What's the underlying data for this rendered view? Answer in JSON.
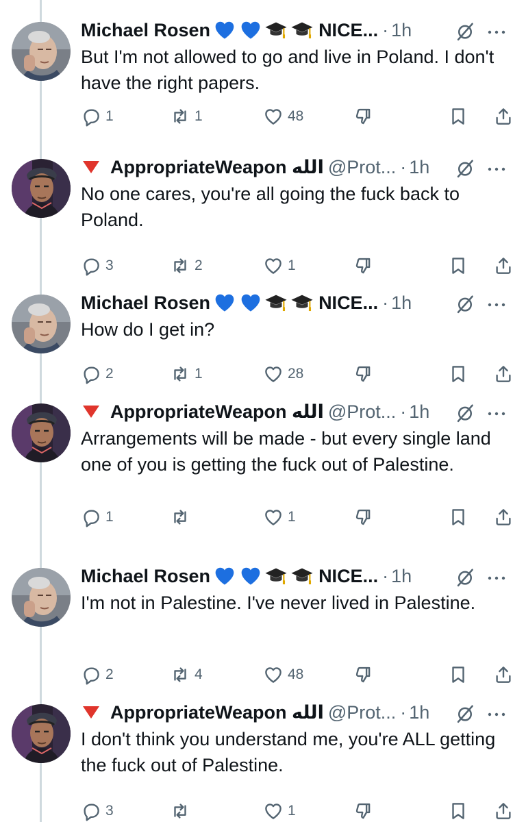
{
  "tweets": [
    {
      "author": "Michael Rosen",
      "author_type": "rosen",
      "name_suffix": "NICE...",
      "handle": "",
      "dot": "·",
      "time": "1h",
      "text": "But I'm not allowed to go and live in Poland. I don't have the right papers.",
      "replies": "1",
      "reposts": "1",
      "likes": "48"
    },
    {
      "author": "AppropriateWeapon الله",
      "author_type": "weapon",
      "name_suffix": "",
      "handle": "@Prot...",
      "dot": "·",
      "time": "1h",
      "text": "No one cares, you're all going the fuck back to Poland.",
      "replies": "3",
      "reposts": "2",
      "likes": "1"
    },
    {
      "author": "Michael Rosen",
      "author_type": "rosen",
      "name_suffix": "NICE...",
      "handle": "",
      "dot": "·",
      "time": "1h",
      "text": "How do I get in?",
      "replies": "2",
      "reposts": "1",
      "likes": "28"
    },
    {
      "author": "AppropriateWeapon الله",
      "author_type": "weapon",
      "name_suffix": "",
      "handle": "@Prot...",
      "dot": "·",
      "time": "1h",
      "text": "Arrangements will be made - but every single land one of you is getting the fuck out of Palestine.",
      "replies": "1",
      "reposts": "",
      "likes": "1"
    },
    {
      "author": "Michael Rosen",
      "author_type": "rosen",
      "name_suffix": "NICE...",
      "handle": "",
      "dot": "·",
      "time": "1h",
      "text": "I'm not in Palestine. I've never lived in Palestine.",
      "replies": "2",
      "reposts": "4",
      "likes": "48"
    },
    {
      "author": "AppropriateWeapon الله",
      "author_type": "weapon",
      "name_suffix": "",
      "handle": "@Prot...",
      "dot": "·",
      "time": "1h",
      "text": "I don't think you understand me, you're ALL getting the fuck out of Palestine.",
      "replies": "3",
      "reposts": "",
      "likes": "1"
    }
  ],
  "icons": {
    "reply": "reply-icon",
    "repost": "repost-icon",
    "like": "heart-icon",
    "downvote": "downvote-icon",
    "bookmark": "bookmark-icon",
    "share": "share-icon",
    "grok": "grok-icon",
    "more": "more-icon"
  },
  "colors": {
    "text": "#0f1419",
    "secondary": "#536471",
    "thread_line": "#cfd9de",
    "blue_heart": "#1d6fe0",
    "red_triangle": "#e0352c"
  }
}
